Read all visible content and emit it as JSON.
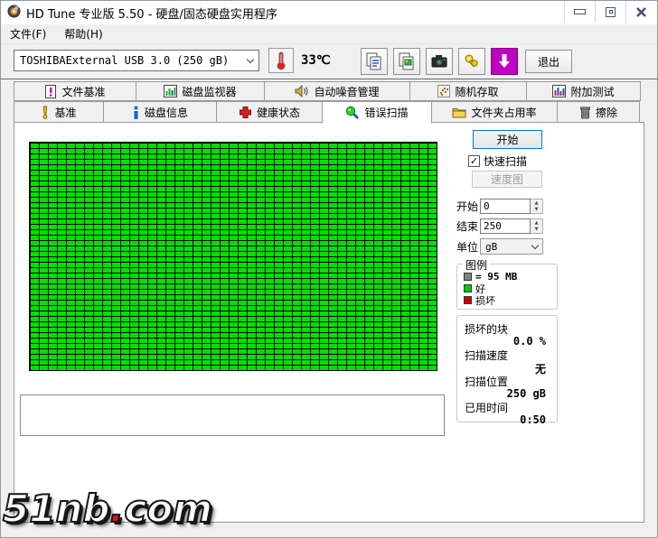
{
  "window": {
    "title": "HD Tune 专业版 5.50 - 硬盘/固态硬盘实用程序"
  },
  "menu": {
    "items": [
      {
        "label": "文件(F)"
      },
      {
        "label": "帮助(H)"
      }
    ]
  },
  "toolbar": {
    "drive_selector": {
      "value": "TOSHIBAExternal USB 3.0 (250 gB)"
    },
    "temperature": "33℃",
    "buttons": [
      {
        "icon": "copy-text-icon"
      },
      {
        "icon": "copy-image-icon"
      },
      {
        "icon": "camera-icon"
      },
      {
        "icon": "keys-icon"
      },
      {
        "icon": "download-icon"
      }
    ],
    "exit_label": "退出"
  },
  "tabs_row1": [
    {
      "label": "文件基准",
      "icon": "file-benchmark-icon"
    },
    {
      "label": "磁盘监视器",
      "icon": "disk-monitor-icon"
    },
    {
      "label": "自动噪音管理",
      "icon": "speaker-icon"
    },
    {
      "label": "随机存取",
      "icon": "random-access-icon"
    },
    {
      "label": "附加测试",
      "icon": "extra-tests-icon"
    }
  ],
  "tabs_row2": [
    {
      "label": "基准",
      "icon": "benchmark-icon",
      "selected": false
    },
    {
      "label": "磁盘信息",
      "icon": "disk-info-icon",
      "selected": false
    },
    {
      "label": "健康状态",
      "icon": "health-icon",
      "selected": false
    },
    {
      "label": "错误扫描",
      "icon": "error-scan-icon",
      "selected": true
    },
    {
      "label": "文件夹占用率",
      "icon": "folder-icon",
      "selected": false
    },
    {
      "label": "擦除",
      "icon": "erase-icon",
      "selected": false
    }
  ],
  "scan_panel": {
    "start_button": "开始",
    "quick_scan": {
      "label": "快速扫描",
      "checked": true
    },
    "speed_map_button": "速度图",
    "start_field": {
      "label": "开始",
      "value": "0"
    },
    "end_field": {
      "label": "结束",
      "value": "250"
    },
    "unit_field": {
      "label": "单位",
      "value": "gB"
    }
  },
  "legend": {
    "title": "图例",
    "block_size_label": "= 95 MB",
    "good_label": "好",
    "bad_label": "损坏",
    "block_color": "#808080",
    "good_color": "#00d000",
    "bad_color": "#d00000"
  },
  "stats": {
    "damaged_blocks_label": "损坏的块",
    "damaged_blocks_value": "0.0 %",
    "scan_speed_label": "扫描速度",
    "scan_speed_value": "无",
    "scan_position_label": "扫描位置",
    "scan_position_value": "250 gB",
    "elapsed_time_label": "已用时间",
    "elapsed_time_value": "0:50"
  },
  "watermark": {
    "text_left": "51nb",
    "dot": ".",
    "text_right": "com"
  },
  "colors": {
    "scan_block_green": "#00e000",
    "download_button_magenta": "#c000c0",
    "focus_blue": "#0078d7"
  }
}
